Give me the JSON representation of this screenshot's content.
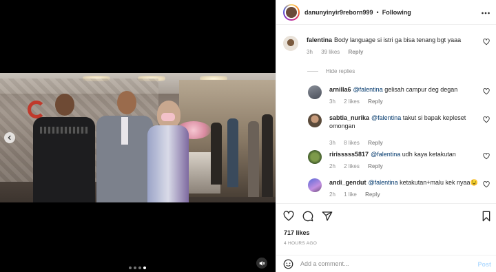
{
  "colors": {
    "accent": "#0095f6",
    "post_disabled": "#b3dbff",
    "mention": "#00376b",
    "muted_text": "#8e8e8e"
  },
  "header": {
    "username": "danunyinyir9reborn999",
    "separator": "•",
    "follow_label": "Following",
    "more_icon": "more-horizontal-icon"
  },
  "media": {
    "carousel_dot_count": 4,
    "carousel_active_index": 3,
    "prev_icon": "chevron-left-icon",
    "mute_icon": "speaker-muted-icon"
  },
  "comments": [
    {
      "username": "falentina",
      "mention": "",
      "text": "Body language si istri ga bisa tenang bgt yaaa",
      "time": "3h",
      "likes": "39 likes",
      "reply_label": "Reply"
    }
  ],
  "hide_replies_label": "Hide replies",
  "replies": [
    {
      "username": "arnilla6",
      "mention": "@falentina",
      "text": " gelisah campur deg degan",
      "time": "3h",
      "likes": "2 likes",
      "reply_label": "Reply"
    },
    {
      "username": "sabtia_nurika",
      "mention": "@falentina",
      "text": " takut si bapak kepleset omongan",
      "time": "3h",
      "likes": "8 likes",
      "reply_label": "Reply"
    },
    {
      "username": "ririsssss5817",
      "mention": "@falentina",
      "text": " udh kaya ketakutan",
      "time": "2h",
      "likes": "2 likes",
      "reply_label": "Reply"
    },
    {
      "username": "andi_gendut",
      "mention": "@falentina",
      "text": " ketakutan+malu kek nyaa",
      "emoji": "😉",
      "time": "2h",
      "likes": "1 like",
      "reply_label": "Reply"
    }
  ],
  "actions": {
    "like_icon": "heart-icon",
    "comment_icon": "comment-icon",
    "share_icon": "send-icon",
    "save_icon": "bookmark-icon",
    "likes_count": "717 likes",
    "time_ago": "4 HOURS AGO"
  },
  "add_comment": {
    "emoji_icon": "smiley-icon",
    "placeholder": "Add a comment...",
    "post_label": "Post"
  }
}
